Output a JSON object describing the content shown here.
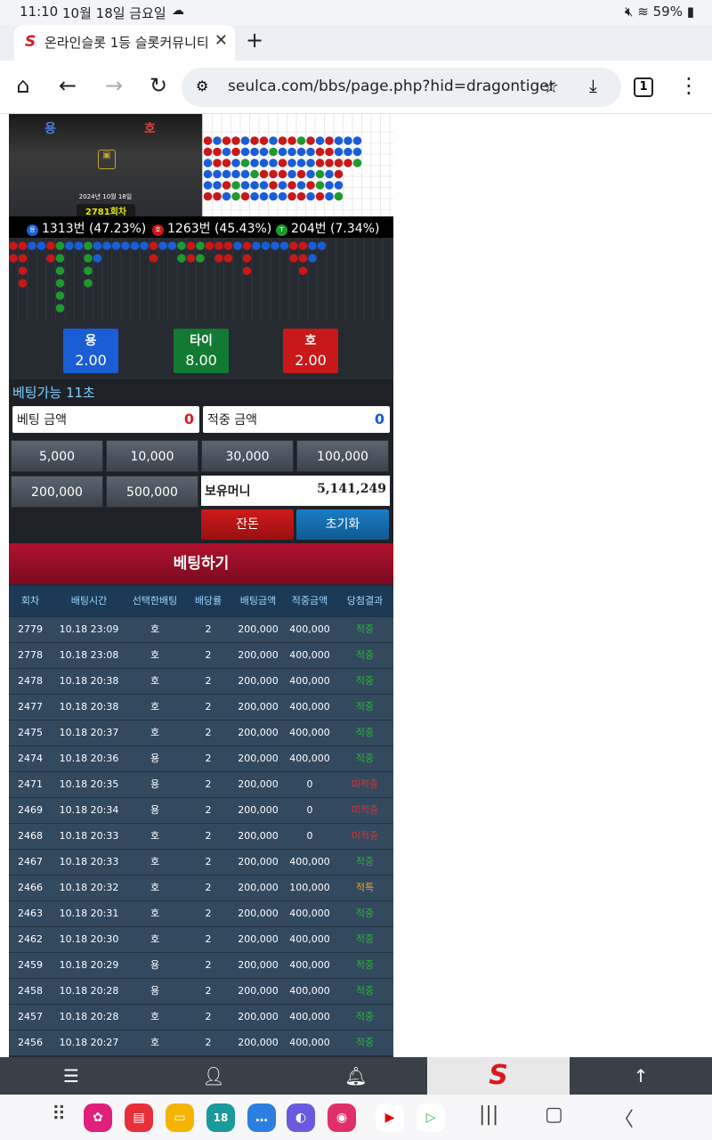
{
  "status": {
    "time": "11:10",
    "date": "10월 18일 금요일",
    "battery": "59%"
  },
  "browser": {
    "tab_title": "온라인슬롯 1등 슬롯커뮤니티 - 슬",
    "url": "seulca.com/bbs/page.php?hid=dragontiger",
    "tab_count": "1"
  },
  "game": {
    "video": {
      "dragon_label": "용",
      "tiger_label": "호",
      "date": "2024년 10월 18일",
      "round": "2781회차"
    },
    "stats": {
      "dragon": "1313번 (47.23%)",
      "tiger": "1263번 (45.43%)",
      "tie": "204번 (7.34%)",
      "dragon_badge": "용",
      "tiger_badge": "호",
      "tie_badge": "T"
    },
    "odds": [
      {
        "name": "용",
        "value": "2.00",
        "color": "#1a5ed6"
      },
      {
        "name": "타이",
        "value": "8.00",
        "color": "#127a33"
      },
      {
        "name": "호",
        "value": "2.00",
        "color": "#c81818"
      }
    ],
    "bet_available": "베팅가능 11초",
    "bet_amount_label": "베팅 금액",
    "bet_amount_value": "0",
    "hit_amount_label": "적중 금액",
    "hit_amount_value": "0",
    "chips": [
      "5,000",
      "10,000",
      "30,000",
      "100,000",
      "200,000",
      "500,000"
    ],
    "balance_label": "보유머니",
    "balance_value": "5,141,249",
    "change_label": "잔돈",
    "reset_label": "초기화",
    "submit_label": "베팅하기"
  },
  "table": {
    "headers": [
      "회차",
      "배팅시간",
      "선택한배팅",
      "배당률",
      "배팅금액",
      "적중금액",
      "당첨결과"
    ],
    "rows": [
      [
        "2779",
        "10.18 23:09",
        "호",
        "2",
        "200,000",
        "400,000",
        "적중"
      ],
      [
        "2778",
        "10.18 23:08",
        "호",
        "2",
        "200,000",
        "400,000",
        "적중"
      ],
      [
        "2478",
        "10.18 20:38",
        "호",
        "2",
        "200,000",
        "400,000",
        "적중"
      ],
      [
        "2477",
        "10.18 20:38",
        "호",
        "2",
        "200,000",
        "400,000",
        "적중"
      ],
      [
        "2475",
        "10.18 20:37",
        "호",
        "2",
        "200,000",
        "400,000",
        "적중"
      ],
      [
        "2474",
        "10.18 20:36",
        "용",
        "2",
        "200,000",
        "400,000",
        "적중"
      ],
      [
        "2471",
        "10.18 20:35",
        "용",
        "2",
        "200,000",
        "0",
        "미적중"
      ],
      [
        "2469",
        "10.18 20:34",
        "용",
        "2",
        "200,000",
        "0",
        "미적중"
      ],
      [
        "2468",
        "10.18 20:33",
        "호",
        "2",
        "200,000",
        "0",
        "미적중"
      ],
      [
        "2467",
        "10.18 20:33",
        "호",
        "2",
        "200,000",
        "400,000",
        "적중"
      ],
      [
        "2466",
        "10.18 20:32",
        "호",
        "2",
        "200,000",
        "100,000",
        "적특"
      ],
      [
        "2463",
        "10.18 20:31",
        "호",
        "2",
        "200,000",
        "400,000",
        "적중"
      ],
      [
        "2462",
        "10.18 20:30",
        "호",
        "2",
        "200,000",
        "400,000",
        "적중"
      ],
      [
        "2459",
        "10.18 20:29",
        "용",
        "2",
        "200,000",
        "400,000",
        "적중"
      ],
      [
        "2458",
        "10.18 20:28",
        "용",
        "2",
        "200,000",
        "400,000",
        "적중"
      ],
      [
        "2457",
        "10.18 20:28",
        "호",
        "2",
        "200,000",
        "400,000",
        "적중"
      ],
      [
        "2456",
        "10.18 20:27",
        "호",
        "2",
        "200,000",
        "400,000",
        "적중"
      ]
    ]
  },
  "icons": {
    "menu": "menu-icon",
    "user": "user-icon",
    "bell": "bell-icon",
    "up": "arrow-up-icon"
  }
}
